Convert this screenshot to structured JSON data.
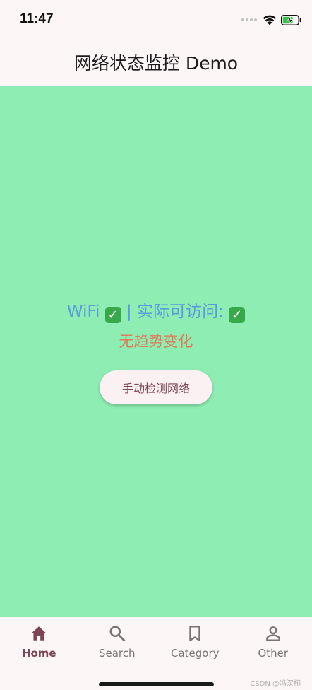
{
  "status_bar": {
    "time": "11:47"
  },
  "app_bar": {
    "title": "网络状态监控 Demo"
  },
  "main": {
    "connection_type": "WiFi",
    "connection_check": "✓",
    "separator": "|",
    "access_label": "实际可访问:",
    "access_check": "✓",
    "trend_text": "无趋势变化",
    "check_button_label": "手动检测网络"
  },
  "bottom_nav": {
    "items": [
      {
        "label": "Home",
        "icon": "home-icon",
        "active": true
      },
      {
        "label": "Search",
        "icon": "search-icon",
        "active": false
      },
      {
        "label": "Category",
        "icon": "bookmark-icon",
        "active": false
      },
      {
        "label": "Other",
        "icon": "person-icon",
        "active": false
      }
    ]
  },
  "watermark": "CSDN @冯汉栩",
  "colors": {
    "body_background": "#8eedb3",
    "status_text": "#5a9bdc",
    "trend_text": "#e07a58",
    "accent": "#7b4556",
    "check_green": "#38a84a"
  }
}
